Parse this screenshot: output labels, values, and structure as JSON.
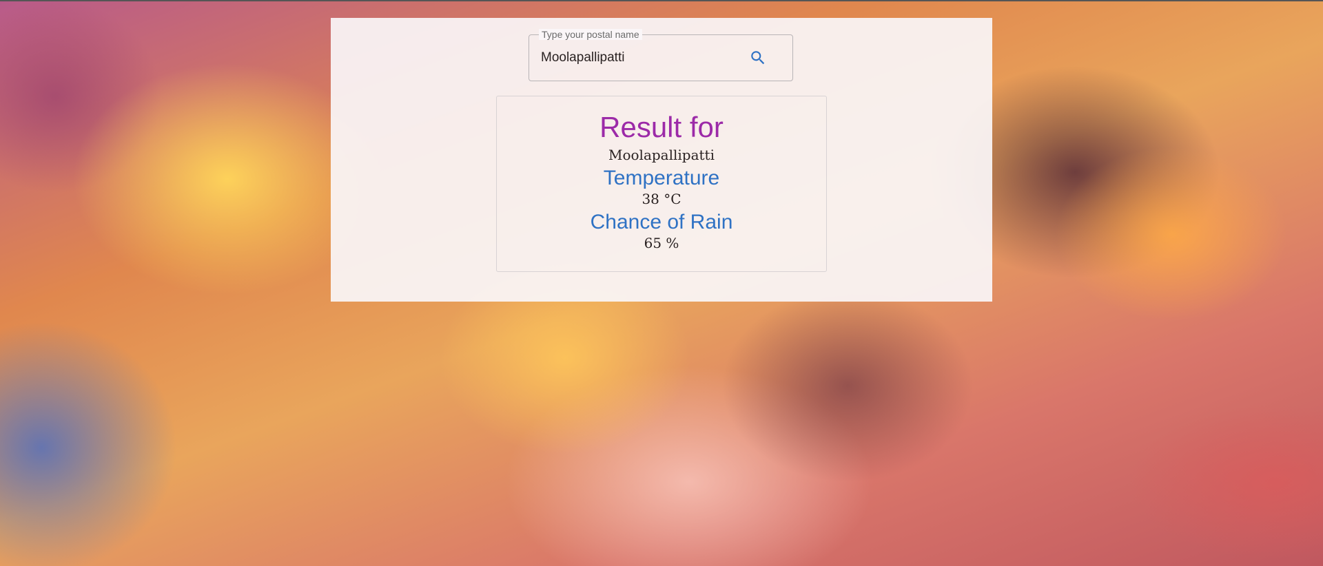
{
  "search": {
    "label": "Type your postal name",
    "value": "Moolapallipatti"
  },
  "result": {
    "title": "Result for",
    "place": "Moolapallipatti",
    "temperature_heading": "Temperature",
    "temperature_value": "38 °C",
    "rain_heading": "Chance of Rain",
    "rain_value": "65 %"
  },
  "colors": {
    "title": "#9c2aa8",
    "heading": "#2f72c4",
    "search_icon": "#2f72c4"
  },
  "icons": {
    "search_button": "search-icon"
  }
}
